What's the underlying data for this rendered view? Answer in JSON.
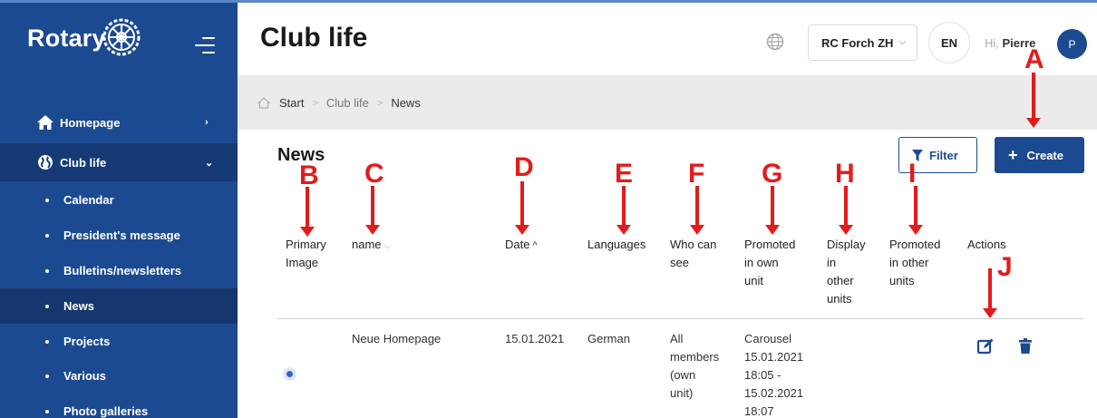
{
  "sidebar": {
    "brand": "Rotary",
    "items": [
      {
        "label": "Homepage",
        "icon": "home-icon",
        "chevron": "›"
      },
      {
        "label": "Club life",
        "icon": "globe-icon",
        "chevron": "⌄"
      }
    ],
    "sub_items": [
      {
        "label": "Calendar"
      },
      {
        "label": "President's message"
      },
      {
        "label": "Bulletins/newsletters"
      },
      {
        "label": "News"
      },
      {
        "label": "Projects"
      },
      {
        "label": "Various"
      },
      {
        "label": "Photo galleries"
      }
    ]
  },
  "header": {
    "title": "Club life",
    "club_select": "RC Forch ZH",
    "language": "EN",
    "greeting_prefix": "Hi,",
    "user_name": "Pierre",
    "avatar_initial": "P"
  },
  "breadcrumb": {
    "items": [
      "Start",
      "Club life",
      "News"
    ]
  },
  "main": {
    "section_title": "News",
    "filter_label": "Filter",
    "create_label": "Create",
    "columns": [
      {
        "line1": "Primary",
        "line2": "Image"
      },
      {
        "label": "name",
        "sort": "⌵"
      },
      {
        "label": "Date",
        "sort": "^"
      },
      {
        "label": "Languages"
      },
      {
        "line1": "Who can",
        "line2": "see"
      },
      {
        "line1": "Promoted",
        "line2": "in own",
        "line3": "unit"
      },
      {
        "line1": "Display",
        "line2": "in",
        "line3": "other",
        "line4": "units"
      },
      {
        "line1": "Promoted",
        "line2": "in other",
        "line3": "units"
      },
      {
        "label": "Actions"
      }
    ],
    "rows": [
      {
        "name": "Neue Homepage",
        "date": "15.01.2021",
        "language": "German",
        "who": [
          "All",
          "members",
          "(own",
          "unit)"
        ],
        "promoted": [
          "Carousel",
          "15.01.2021",
          "18:05 -",
          "15.02.2021",
          "18:07"
        ]
      }
    ]
  },
  "annotations": [
    "A",
    "B",
    "C",
    "D",
    "E",
    "F",
    "G",
    "H",
    "I",
    "J"
  ],
  "colors": {
    "brand_blue": "#1c4a91",
    "annotation_red": "#e21c1c",
    "crumb_band": "#ebebeb"
  }
}
